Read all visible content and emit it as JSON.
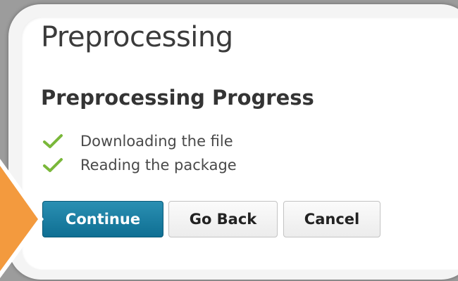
{
  "page": {
    "title": "Preprocessing"
  },
  "progress": {
    "heading": "Preprocessing Progress",
    "steps": [
      {
        "label": "Downloading the file",
        "status": "done",
        "icon": "checkmark-icon"
      },
      {
        "label": "Reading the package",
        "status": "done",
        "icon": "checkmark-icon"
      }
    ]
  },
  "actions": {
    "continue_label": "Continue",
    "back_label": "Go Back",
    "cancel_label": "Cancel"
  },
  "colors": {
    "primary_button": "#167a9e",
    "check": "#7ab83a",
    "highlight_arrow": "#f39a3e",
    "background": "#9c9c9c"
  }
}
